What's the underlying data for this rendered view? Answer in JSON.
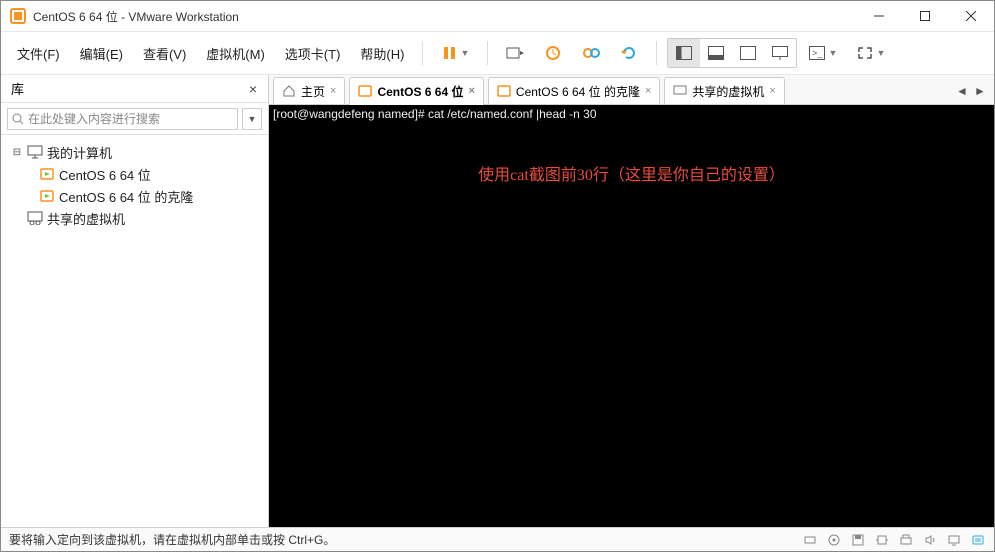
{
  "window": {
    "title": "CentOS 6 64 位 - VMware Workstation"
  },
  "menu": {
    "file": "文件(F)",
    "edit": "编辑(E)",
    "view": "查看(V)",
    "vm": "虚拟机(M)",
    "tabs": "选项卡(T)",
    "help": "帮助(H)"
  },
  "sidebar": {
    "title": "库",
    "search_placeholder": "在此处键入内容进行搜索",
    "tree": {
      "root": "我的计算机",
      "items": [
        "CentOS 6 64 位",
        "CentOS 6 64 位 的克隆"
      ],
      "shared": "共享的虚拟机"
    }
  },
  "tabs": {
    "home": "主页",
    "t1": "CentOS 6 64 位",
    "t2": "CentOS 6 64 位 的克隆",
    "t3": "共享的虚拟机"
  },
  "console": {
    "prompt": "[root@wangdefeng named]# cat /etc/named.conf |head -n 30",
    "overlay": "使用cat截图前30行（这里是你自己的设置）"
  },
  "statusbar": {
    "message": "要将输入定向到该虚拟机，请在虚拟机内部单击或按 Ctrl+G。"
  }
}
